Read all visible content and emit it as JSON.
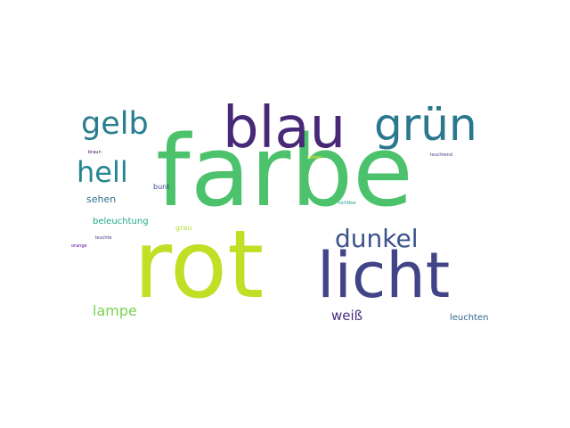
{
  "word_cloud": {
    "words": [
      {
        "text": "farbe",
        "color": "#4cc26c"
      },
      {
        "text": "rot",
        "color": "#c0df25"
      },
      {
        "text": "licht",
        "color": "#414487"
      },
      {
        "text": "blau",
        "color": "#482878"
      },
      {
        "text": "grün",
        "color": "#2a788e"
      },
      {
        "text": "gelb",
        "color": "#287d8e"
      },
      {
        "text": "hell",
        "color": "#25858e"
      },
      {
        "text": "dunkel",
        "color": "#3b528b"
      },
      {
        "text": "lampe",
        "color": "#7ad151"
      },
      {
        "text": "weiß",
        "color": "#472d7b"
      },
      {
        "text": "sehen",
        "color": "#2c728e"
      },
      {
        "text": "beleuchtung",
        "color": "#22a884"
      },
      {
        "text": "bunt",
        "color": "#3e4989"
      },
      {
        "text": "grau",
        "color": "#b5de2b"
      },
      {
        "text": "leuchten",
        "color": "#31688e"
      },
      {
        "text": "braun",
        "color": "#440154"
      },
      {
        "text": "farben",
        "color": "#fde725"
      },
      {
        "text": "leuchtend",
        "color": "#46337e"
      },
      {
        "text": "sichtbar",
        "color": "#1e9b8a"
      },
      {
        "text": "leuchte",
        "color": "#453781"
      },
      {
        "text": "orange",
        "color": "#6a00a8"
      }
    ]
  }
}
